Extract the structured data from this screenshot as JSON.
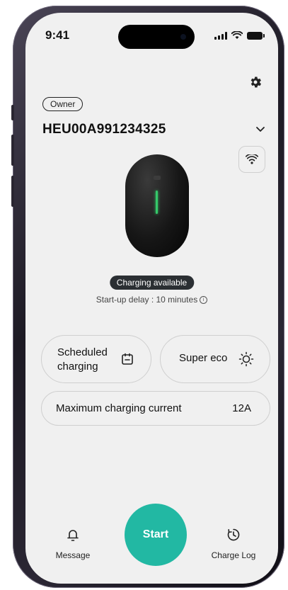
{
  "status_bar": {
    "time": "9:41"
  },
  "header": {
    "role_badge": "Owner",
    "device_id": "HEU00A991234325"
  },
  "device": {
    "status": "Charging available",
    "delay_text": "Start-up delay : 10 minutes",
    "led_color": "#35c96a"
  },
  "cards": {
    "scheduled_line1": "Scheduled",
    "scheduled_line2": "charging",
    "super_eco": "Super eco",
    "max_current_label": "Maximum charging current",
    "max_current_value": "12A"
  },
  "bottom_nav": {
    "message_label": "Message",
    "start_label": "Start",
    "charge_log_label": "Charge Log"
  },
  "icons": [
    "settings-gear-icon",
    "chevron-down-icon",
    "wifi-icon",
    "info-icon",
    "calendar-icon",
    "sun-icon",
    "bell-icon",
    "clock-history-icon"
  ],
  "colors": {
    "accent": "#22b8a3",
    "pill_bg": "#2b2f33",
    "screen_bg": "#f0f0f0"
  }
}
